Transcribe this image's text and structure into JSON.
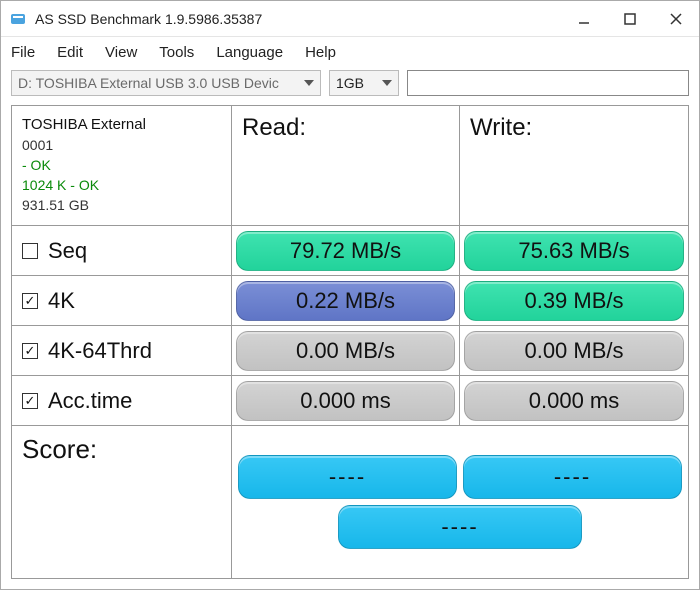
{
  "window": {
    "title": "AS SSD Benchmark 1.9.5986.35387"
  },
  "menu": {
    "file": "File",
    "edit": "Edit",
    "view": "View",
    "tools": "Tools",
    "language": "Language",
    "help": "Help"
  },
  "toolbar": {
    "drive_selected": "D: TOSHIBA External USB 3.0 USB Devic",
    "size_selected": "1GB",
    "text_value": ""
  },
  "device": {
    "name": "TOSHIBA External",
    "firmware": "0001",
    "status": "- OK",
    "align": "1024 K - OK",
    "capacity": "931.51 GB"
  },
  "headers": {
    "read": "Read:",
    "write": "Write:",
    "score": "Score:"
  },
  "rows": {
    "seq": {
      "label": "Seq",
      "checked": false,
      "read": "79.72 MB/s",
      "write": "75.63 MB/s",
      "read_color": "green",
      "write_color": "green"
    },
    "fourk": {
      "label": "4K",
      "checked": true,
      "read": "0.22 MB/s",
      "write": "0.39 MB/s",
      "read_color": "blue",
      "write_color": "green"
    },
    "thrd": {
      "label": "4K-64Thrd",
      "checked": true,
      "read": "0.00 MB/s",
      "write": "0.00 MB/s",
      "read_color": "gray",
      "write_color": "gray"
    },
    "acc": {
      "label": "Acc.time",
      "checked": true,
      "read": "0.000 ms",
      "write": "0.000 ms",
      "read_color": "gray",
      "write_color": "gray"
    }
  },
  "score": {
    "read": "----",
    "write": "----",
    "total": "----"
  },
  "colors": {
    "green": "#22d39b",
    "blue": "#5f75c6",
    "gray": "#c2c2c2",
    "cyan": "#17b7ea"
  }
}
